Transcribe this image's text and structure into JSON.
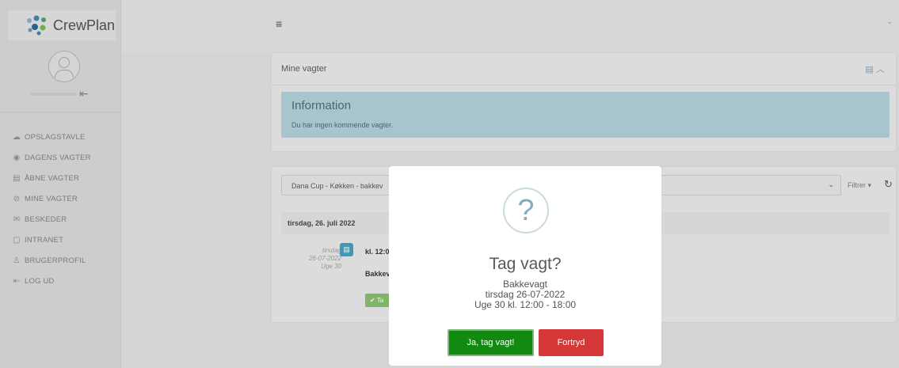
{
  "app": {
    "logo_text": "CrewPlan"
  },
  "sidebar": {
    "items": [
      {
        "icon": "chat-icon",
        "label": "OPSLAGSTAVLE"
      },
      {
        "icon": "location-pin-icon",
        "label": "DAGENS VAGTER"
      },
      {
        "icon": "calendar-icon",
        "label": "ÅBNE VAGTER"
      },
      {
        "icon": "check-circle-icon",
        "label": "MINE VAGTER"
      },
      {
        "icon": "envelope-icon",
        "label": "BESKEDER"
      },
      {
        "icon": "book-icon",
        "label": "INTRANET"
      },
      {
        "icon": "user-icon",
        "label": "BRUGERPROFIL"
      },
      {
        "icon": "logout-icon",
        "label": "LOG UD"
      }
    ]
  },
  "main": {
    "my_shifts": {
      "title": "Mine vagter",
      "info_title": "Information",
      "info_text": "Du har ingen kommende vagter."
    },
    "shift_list": {
      "filter_value": "Dana Cup - Køkken - bakkev",
      "filter_button": "Filtrer",
      "date_header": "tirsdag, 26. juli 2022",
      "entry": {
        "day": "tirsdag",
        "date": "26-07-2022",
        "week": "Uge 30",
        "time": "kl. 12:0",
        "name": "Bakkev",
        "button": "Ta"
      }
    }
  },
  "modal": {
    "icon": "question-icon",
    "icon_glyph": "?",
    "title": "Tag vagt?",
    "line1": "Bakkevagt",
    "line2": "tirsdag 26-07-2022",
    "line3": "Uge 30 kl. 12:00 - 18:00",
    "confirm_label": "Ja, tag vagt!",
    "cancel_label": "Fortryd"
  },
  "colors": {
    "confirm": "#128a12",
    "cancel": "#d33737",
    "info_bg": "#a8c4cd",
    "accent": "#3f98b5"
  }
}
